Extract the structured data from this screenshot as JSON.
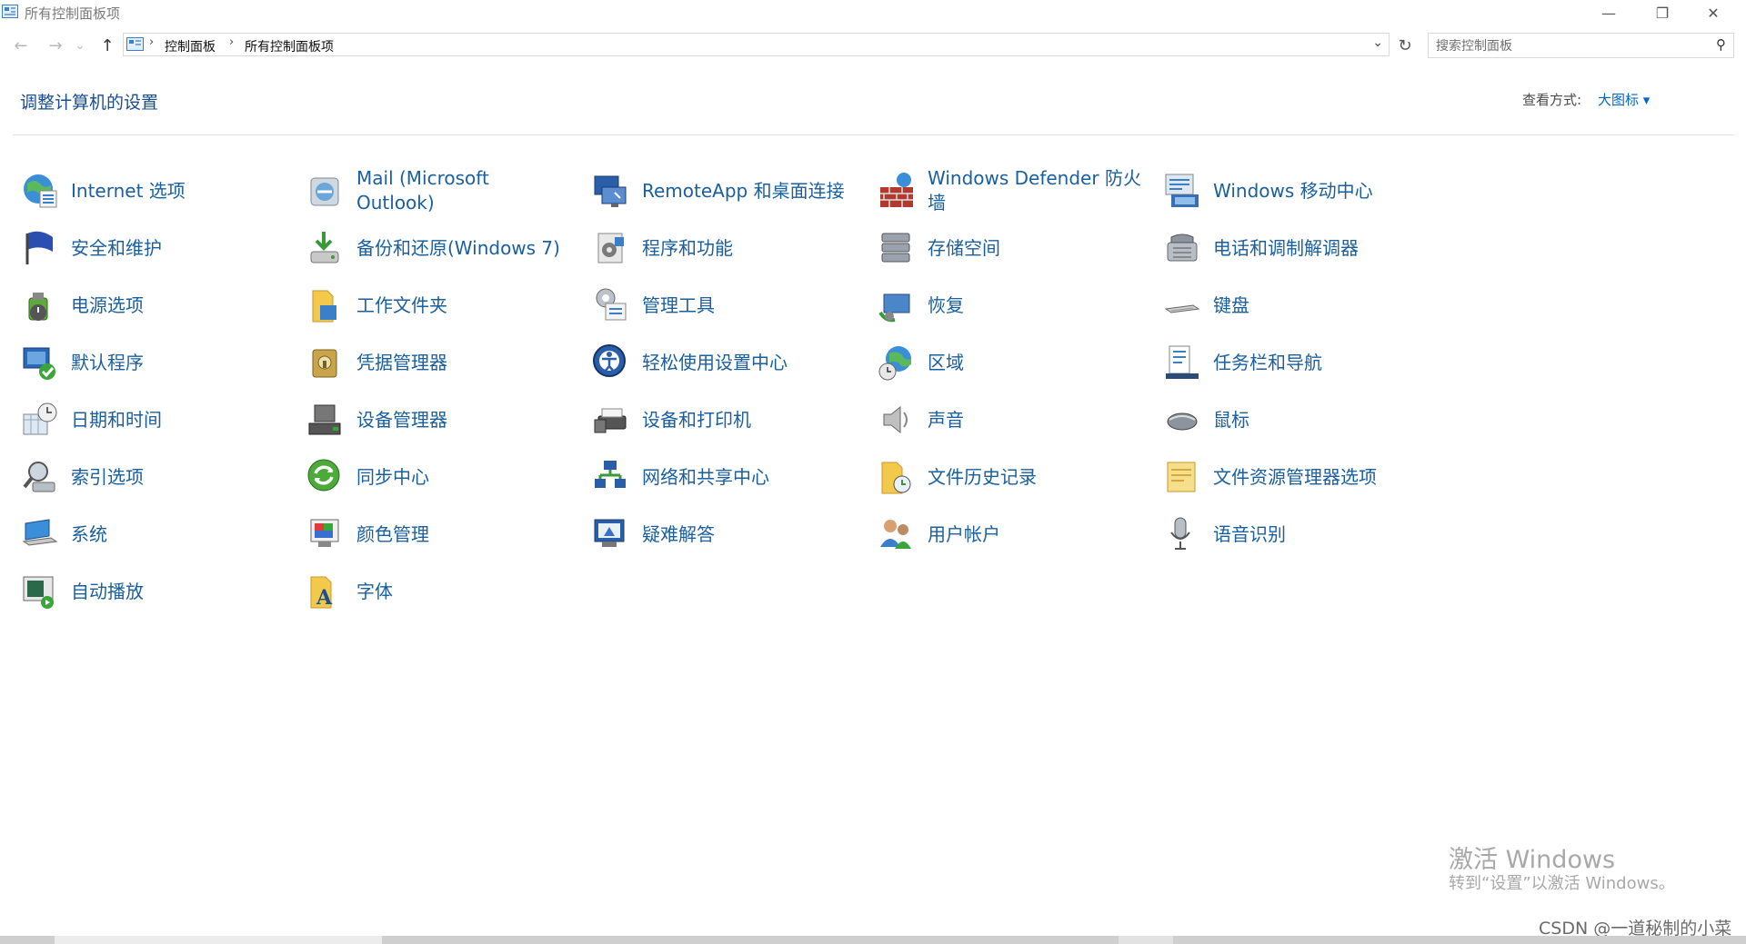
{
  "window": {
    "title": "所有控制面板项",
    "minimize_glyph": "—",
    "restore_glyph": "❐",
    "close_glyph": "✕"
  },
  "nav": {
    "back_glyph": "←",
    "forward_glyph": "→",
    "recent_glyph": "⌄",
    "up_glyph": "↑",
    "crumb_separator": "›",
    "breadcrumbs": [
      "控制面板",
      "所有控制面板项"
    ],
    "dropdown_glyph": "⌄",
    "refresh_glyph": "↻"
  },
  "search": {
    "placeholder": "搜索控制面板",
    "icon_glyph": "⚲"
  },
  "header": {
    "title": "调整计算机的设置",
    "view_by_label": "查看方式:",
    "view_by_value": "大图标 ▾"
  },
  "items": [
    {
      "label": "Internet 选项",
      "icon": "internet-options-icon"
    },
    {
      "label": "Mail (Microsoft Outlook)",
      "icon": "mail-icon"
    },
    {
      "label": "RemoteApp 和桌面连接",
      "icon": "remoteapp-icon"
    },
    {
      "label": "Windows Defender 防火墙",
      "icon": "firewall-icon"
    },
    {
      "label": "Windows 移动中心",
      "icon": "mobility-center-icon"
    },
    {
      "label": "安全和维护",
      "icon": "security-flag-icon"
    },
    {
      "label": "备份和还原(Windows 7)",
      "icon": "backup-icon"
    },
    {
      "label": "程序和功能",
      "icon": "programs-icon"
    },
    {
      "label": "存储空间",
      "icon": "storage-spaces-icon"
    },
    {
      "label": "电话和调制解调器",
      "icon": "phone-modem-icon"
    },
    {
      "label": "电源选项",
      "icon": "power-options-icon"
    },
    {
      "label": "工作文件夹",
      "icon": "work-folders-icon"
    },
    {
      "label": "管理工具",
      "icon": "admin-tools-icon"
    },
    {
      "label": "恢复",
      "icon": "recovery-icon"
    },
    {
      "label": "键盘",
      "icon": "keyboard-icon"
    },
    {
      "label": "默认程序",
      "icon": "default-programs-icon"
    },
    {
      "label": "凭据管理器",
      "icon": "credential-manager-icon"
    },
    {
      "label": "轻松使用设置中心",
      "icon": "ease-of-access-icon"
    },
    {
      "label": "区域",
      "icon": "region-icon"
    },
    {
      "label": "任务栏和导航",
      "icon": "taskbar-icon"
    },
    {
      "label": "日期和时间",
      "icon": "date-time-icon"
    },
    {
      "label": "设备管理器",
      "icon": "device-manager-icon"
    },
    {
      "label": "设备和打印机",
      "icon": "devices-printers-icon"
    },
    {
      "label": "声音",
      "icon": "sound-icon"
    },
    {
      "label": "鼠标",
      "icon": "mouse-icon"
    },
    {
      "label": "索引选项",
      "icon": "indexing-icon"
    },
    {
      "label": "同步中心",
      "icon": "sync-center-icon"
    },
    {
      "label": "网络和共享中心",
      "icon": "network-icon"
    },
    {
      "label": "文件历史记录",
      "icon": "file-history-icon"
    },
    {
      "label": "文件资源管理器选项",
      "icon": "explorer-options-icon"
    },
    {
      "label": "系统",
      "icon": "system-icon"
    },
    {
      "label": "颜色管理",
      "icon": "color-management-icon"
    },
    {
      "label": "疑难解答",
      "icon": "troubleshooting-icon"
    },
    {
      "label": "用户帐户",
      "icon": "user-accounts-icon"
    },
    {
      "label": "语音识别",
      "icon": "speech-recognition-icon"
    },
    {
      "label": "自动播放",
      "icon": "autoplay-icon"
    },
    {
      "label": "字体",
      "icon": "fonts-icon"
    }
  ],
  "watermark": {
    "line1": "激活 Windows",
    "line2": "转到“设置”以激活 Windows。"
  },
  "credit": "CSDN @一道秘制的小菜"
}
